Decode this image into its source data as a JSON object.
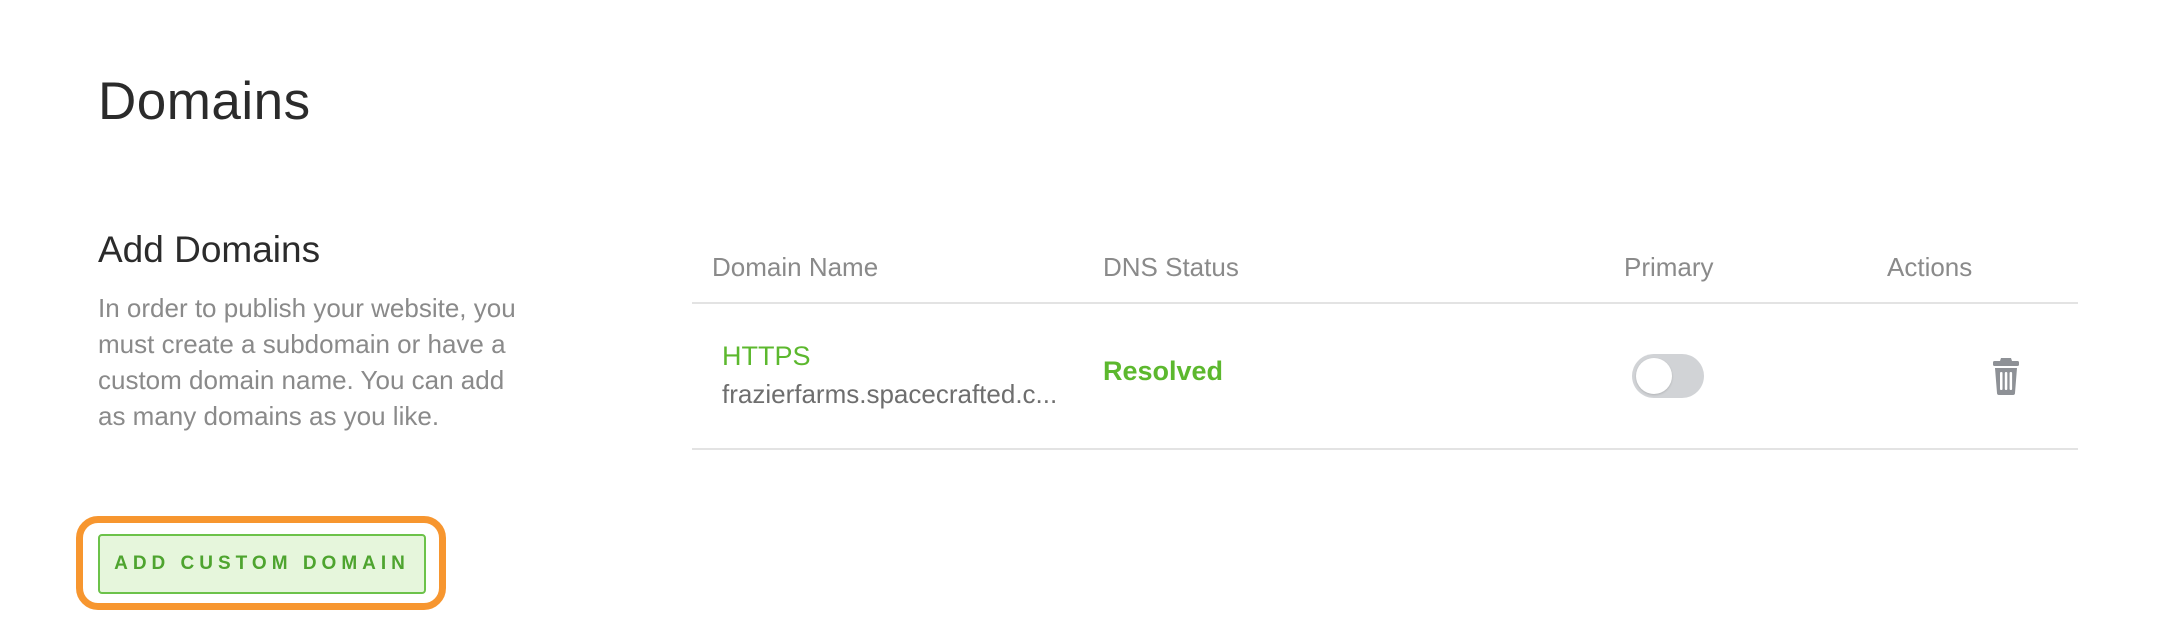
{
  "page": {
    "title": "Domains"
  },
  "add_section": {
    "title": "Add Domains",
    "description": "In order to publish your website, you must create a subdomain or have a custom domain name. You can add as many domains as you like.",
    "button_label": "ADD CUSTOM DOMAIN"
  },
  "table": {
    "headers": {
      "domain_name": "Domain Name",
      "dns_status": "DNS Status",
      "primary": "Primary",
      "actions": "Actions"
    },
    "rows": [
      {
        "protocol": "HTTPS",
        "domain": "frazierfarms.spacecrafted.c...",
        "dns_status": "Resolved",
        "primary": false,
        "action_icon": "trash-icon"
      }
    ]
  },
  "colors": {
    "accent_green": "#5cb82e",
    "highlight_orange": "#f7962f",
    "toggle_off": "#d1d3d6",
    "button_bg": "#e6f6dc"
  }
}
